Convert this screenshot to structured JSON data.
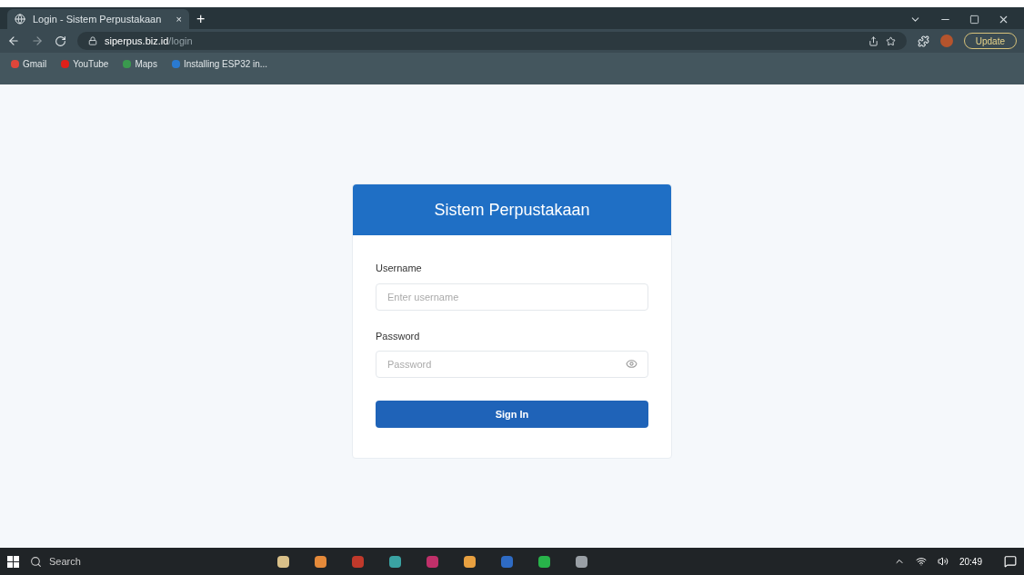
{
  "browser": {
    "tab": {
      "title": "Login - Sistem Perpustakaan",
      "close": "×"
    },
    "new_tab": "+",
    "url": {
      "host": "siperpus.biz.id",
      "path": "/login"
    },
    "update_button": "Update",
    "bookmarks": [
      {
        "label": "Gmail",
        "color": "#e0463a"
      },
      {
        "label": "YouTube",
        "color": "#e0201a"
      },
      {
        "label": "Maps",
        "color": "#3a9a4e"
      },
      {
        "label": "Installing ESP32 in...",
        "color": "#2a7ad0"
      }
    ]
  },
  "login": {
    "title": "Sistem Perpustakaan",
    "fields": [
      {
        "label": "Username",
        "placeholder": "Enter username",
        "kind": "text"
      },
      {
        "label": "Password",
        "placeholder": "Password",
        "kind": "password"
      }
    ],
    "submit": "Sign In"
  },
  "taskbar": {
    "search": "Search",
    "apps": [
      {
        "color": "#d9c089"
      },
      {
        "color": "#e58a3a"
      },
      {
        "color": "#c0392b"
      },
      {
        "color": "#3aa3a3"
      },
      {
        "color": "#c0306a"
      },
      {
        "color": "#e8a040"
      },
      {
        "color": "#2e6bc4"
      },
      {
        "color": "#28b34a"
      },
      {
        "color": "#9aa0a6"
      }
    ],
    "time": "20:49"
  }
}
